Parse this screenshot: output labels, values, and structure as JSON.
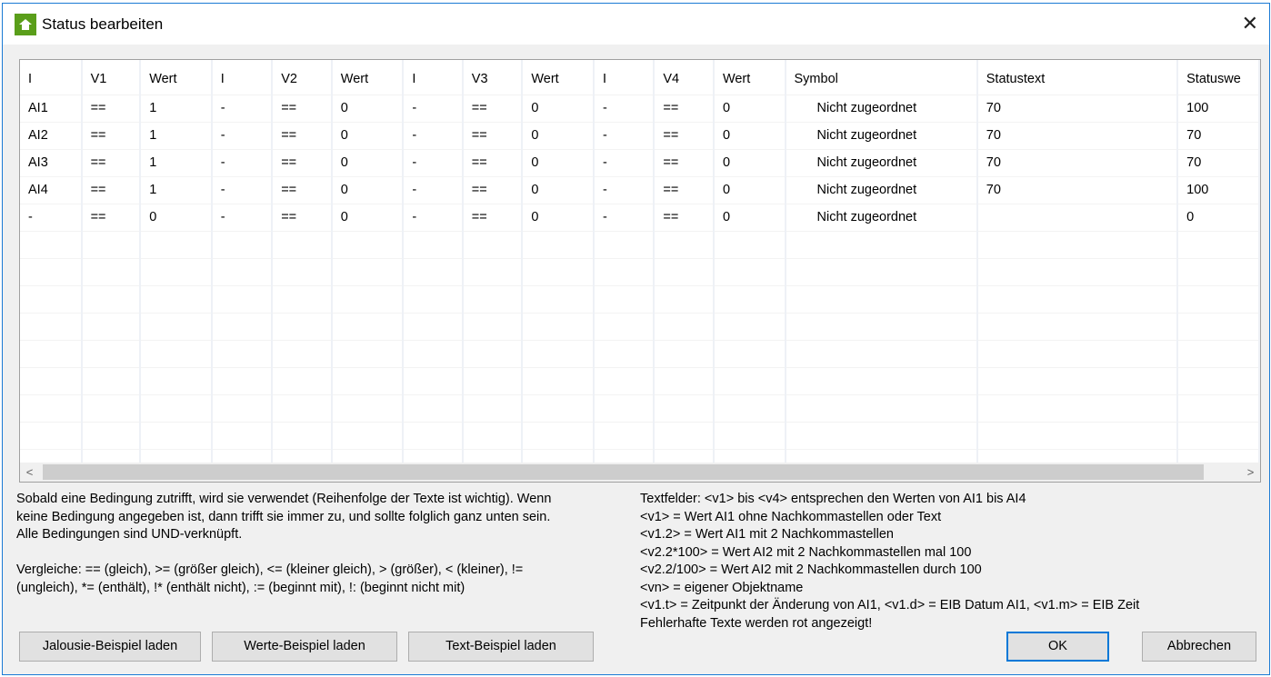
{
  "window": {
    "title": "Status bearbeiten",
    "close": "✕"
  },
  "table": {
    "columns": [
      "I",
      "V1",
      "Wert",
      "I",
      "V2",
      "Wert",
      "I",
      "V3",
      "Wert",
      "I",
      "V4",
      "Wert",
      "Symbol",
      "Statustext",
      "Statuswe"
    ],
    "rows": [
      [
        "AI1",
        "==",
        "1",
        "-",
        "==",
        "0",
        "-",
        "==",
        "0",
        "-",
        "==",
        "0",
        "Nicht zugeordnet",
        "70",
        "100"
      ],
      [
        "AI2",
        "==",
        "1",
        "-",
        "==",
        "0",
        "-",
        "==",
        "0",
        "-",
        "==",
        "0",
        "Nicht zugeordnet",
        "70",
        "70"
      ],
      [
        "AI3",
        "==",
        "1",
        "-",
        "==",
        "0",
        "-",
        "==",
        "0",
        "-",
        "==",
        "0",
        "Nicht zugeordnet",
        "70",
        "70"
      ],
      [
        "AI4",
        "==",
        "1",
        "-",
        "==",
        "0",
        "-",
        "==",
        "0",
        "-",
        "==",
        "0",
        "Nicht zugeordnet",
        "70",
        "100"
      ],
      [
        "-",
        "==",
        "0",
        "-",
        "==",
        "0",
        "-",
        "==",
        "0",
        "-",
        "==",
        "0",
        "Nicht zugeordnet",
        "",
        "0"
      ]
    ]
  },
  "help_left": [
    "Sobald eine Bedingung zutrifft, wird sie verwendet (Reihenfolge der Texte ist wichtig). Wenn",
    "keine Bedingung angegeben ist, dann trifft sie immer zu, und sollte folglich ganz unten sein.",
    "Alle Bedingungen sind UND-verknüpft.",
    "",
    "Vergleiche: == (gleich), >= (größer gleich), <= (kleiner gleich), > (größer), < (kleiner), !=",
    "(ungleich), *= (enthält), !* (enthält nicht), := (beginnt mit), !: (beginnt nicht mit)"
  ],
  "help_right": [
    "Textfelder: <v1> bis <v4> entsprechen den Werten von AI1 bis AI4",
    "<v1> = Wert AI1 ohne Nachkommastellen oder Text",
    "<v1.2> = Wert AI1 mit 2 Nachkommastellen",
    "<v2.2*100> = Wert AI2 mit 2 Nachkommastellen mal 100",
    "<v2.2/100> = Wert AI2 mit 2 Nachkommastellen durch 100",
    "<vn> = eigener Objektname",
    "<v1.t> = Zeitpunkt der Änderung von AI1, <v1.d> = EIB Datum AI1, <v1.m> = EIB Zeit",
    "Fehlerhafte Texte werden rot angezeigt!"
  ],
  "buttons": {
    "jalousie": "Jalousie-Beispiel laden",
    "werte": "Werte-Beispiel laden",
    "text": "Text-Beispiel laden",
    "ok": "OK",
    "cancel": "Abbrechen"
  },
  "scroll": {
    "left": "<",
    "right": ">"
  }
}
